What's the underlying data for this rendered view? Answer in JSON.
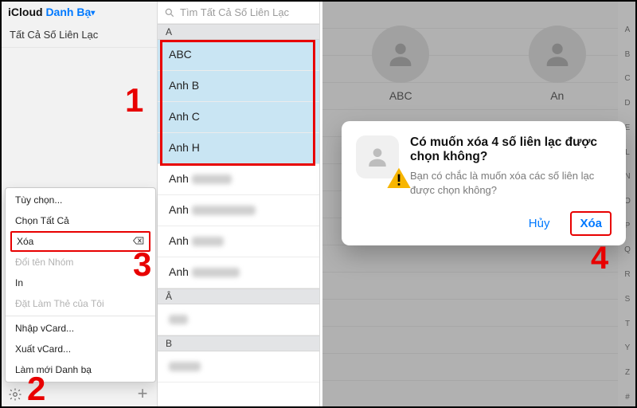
{
  "sidebar": {
    "title_prefix": "iCloud",
    "title_link": "Danh Bạ",
    "all_contacts": "Tất Cả Số Liên Lạc"
  },
  "contextMenu": {
    "items": [
      {
        "label": "Tùy chọn...",
        "disabled": false
      },
      {
        "label": "Chọn Tất Cả",
        "disabled": false
      },
      {
        "label": "Xóa",
        "disabled": false,
        "boxed": true,
        "hasErase": true
      },
      {
        "label": "Đổi tên Nhóm",
        "disabled": true
      },
      {
        "label": "In",
        "disabled": false
      },
      {
        "label": "Đặt Làm Thẻ của Tôi",
        "disabled": true
      },
      {
        "sep": true
      },
      {
        "label": "Nhập vCard...",
        "disabled": false
      },
      {
        "label": "Xuất vCard...",
        "disabled": false
      },
      {
        "label": "Làm mới Danh bạ",
        "disabled": false
      }
    ]
  },
  "list": {
    "search_placeholder": "Tìm Tất Cả Số Liên Lạc",
    "groups": [
      {
        "letter": "A",
        "contacts": [
          {
            "name": "ABC",
            "selected": true
          },
          {
            "name": "Anh B",
            "selected": true
          },
          {
            "name": "Anh C",
            "selected": true
          },
          {
            "name": "Anh H",
            "selected": true
          },
          {
            "name": "Anh",
            "blurW": 50
          },
          {
            "name": "Anh",
            "blurW": 80
          },
          {
            "name": "Anh",
            "blurW": 40
          },
          {
            "name": "Anh",
            "blurW": 60
          }
        ]
      },
      {
        "letter": "Â",
        "contacts": [
          {
            "name": "",
            "blurW": 24
          }
        ]
      },
      {
        "letter": "B",
        "contacts": [
          {
            "name": "",
            "blurW": 40
          }
        ]
      }
    ]
  },
  "detail": {
    "avatars": [
      {
        "label": "ABC"
      },
      {
        "label": "An"
      }
    ]
  },
  "dialog": {
    "title": "Có muốn xóa 4 số liên lạc được chọn không?",
    "subtitle": "Bạn có chắc là muốn xóa các số liên lạc được chọn không?",
    "cancel": "Hủy",
    "confirm": "Xóa"
  },
  "indexLetters": [
    "A",
    "B",
    "C",
    "D",
    "E",
    "L",
    "N",
    "O",
    "P",
    "Q",
    "R",
    "S",
    "T",
    "Y",
    "Z",
    "#"
  ],
  "annotations": {
    "1": "1",
    "2": "2",
    "3": "3",
    "4": "4"
  }
}
